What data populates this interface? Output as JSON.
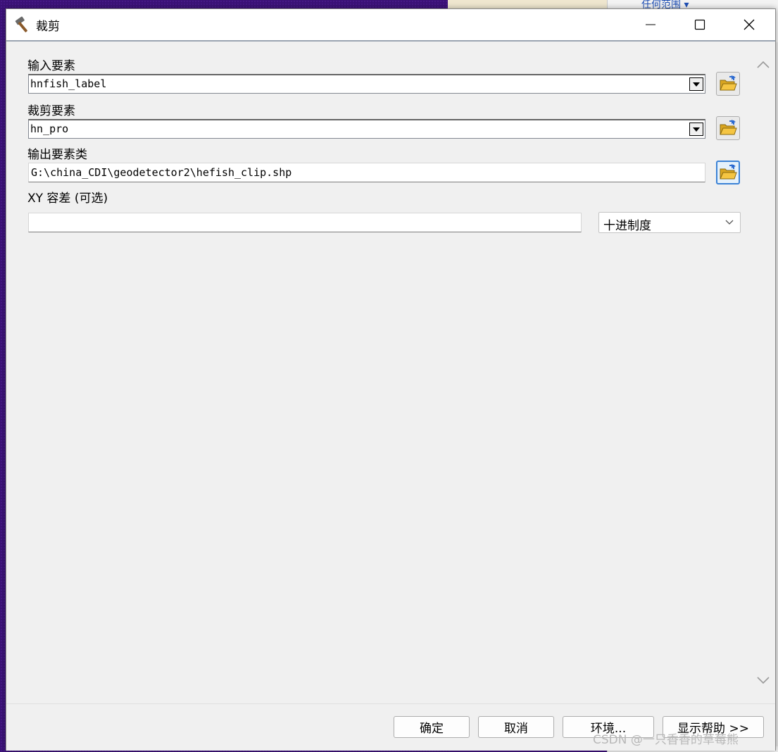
{
  "background": {
    "right_panel_link": "任何范围 ▾"
  },
  "window": {
    "title": "裁剪",
    "icons": {
      "title": "hammer-icon",
      "minimize": "minimize-icon",
      "maximize": "maximize-icon",
      "close": "close-icon"
    }
  },
  "form": {
    "input_features": {
      "label": "输入要素",
      "value": "hnfish_label"
    },
    "clip_features": {
      "label": "裁剪要素",
      "value": "hn_pro"
    },
    "output_class": {
      "label": "输出要素类",
      "value": "G:\\china_CDI\\geodetector2\\hefish_clip.shp"
    },
    "xy_tolerance": {
      "label": "XY 容差 (可选)",
      "value": "",
      "unit": "十进制度"
    }
  },
  "buttons": {
    "ok": "确定",
    "cancel": "取消",
    "environments": "环境...",
    "show_help": "显示帮助 >>"
  },
  "watermark": "CSDN @一只香香的草莓熊",
  "colors": {
    "focus_border": "#3b82d6",
    "folder_yellow": "#f5c542"
  }
}
